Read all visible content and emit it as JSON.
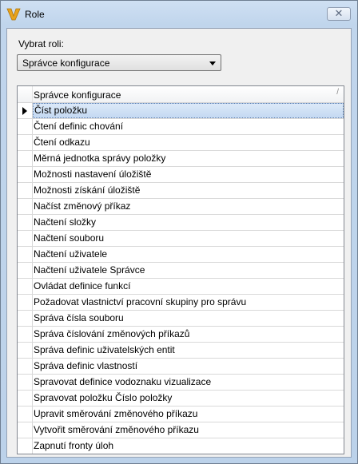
{
  "window": {
    "title": "Role",
    "icon": "vault-logo-icon",
    "close_glyph": "✕"
  },
  "role_selector": {
    "label": "Vybrat roli:",
    "selected": "Správce konfigurace"
  },
  "grid": {
    "column_header": "Správce konfigurace",
    "sort_glyph": "/",
    "selected_index": 0,
    "rows": [
      "Číst položku",
      "Čtení definic chování",
      "Čtení odkazu",
      "Měrná jednotka správy položky",
      "Možnosti nastavení úložiště",
      "Možnosti získání úložiště",
      "Načíst změnový příkaz",
      "Načtení složky",
      "Načtení souboru",
      "Načtení uživatele",
      "Načtení uživatele Správce",
      "Ovládat definice funkcí",
      "Požadovat vlastnictví pracovní skupiny pro správu",
      "Správa čísla souboru",
      "Správa číslování změnových příkazů",
      "Správa definic uživatelských entit",
      "Správa definic vlastností",
      "Spravovat definice vodoznaku vizualizace",
      "Spravovat položku Číslo položky",
      "Upravit směrování změnového příkazu",
      "Vytvořit směrování změnového příkazu",
      "Zapnutí fronty úloh"
    ]
  },
  "colors": {
    "selection": "#c4d9f2",
    "logo": "#e8a31c"
  }
}
